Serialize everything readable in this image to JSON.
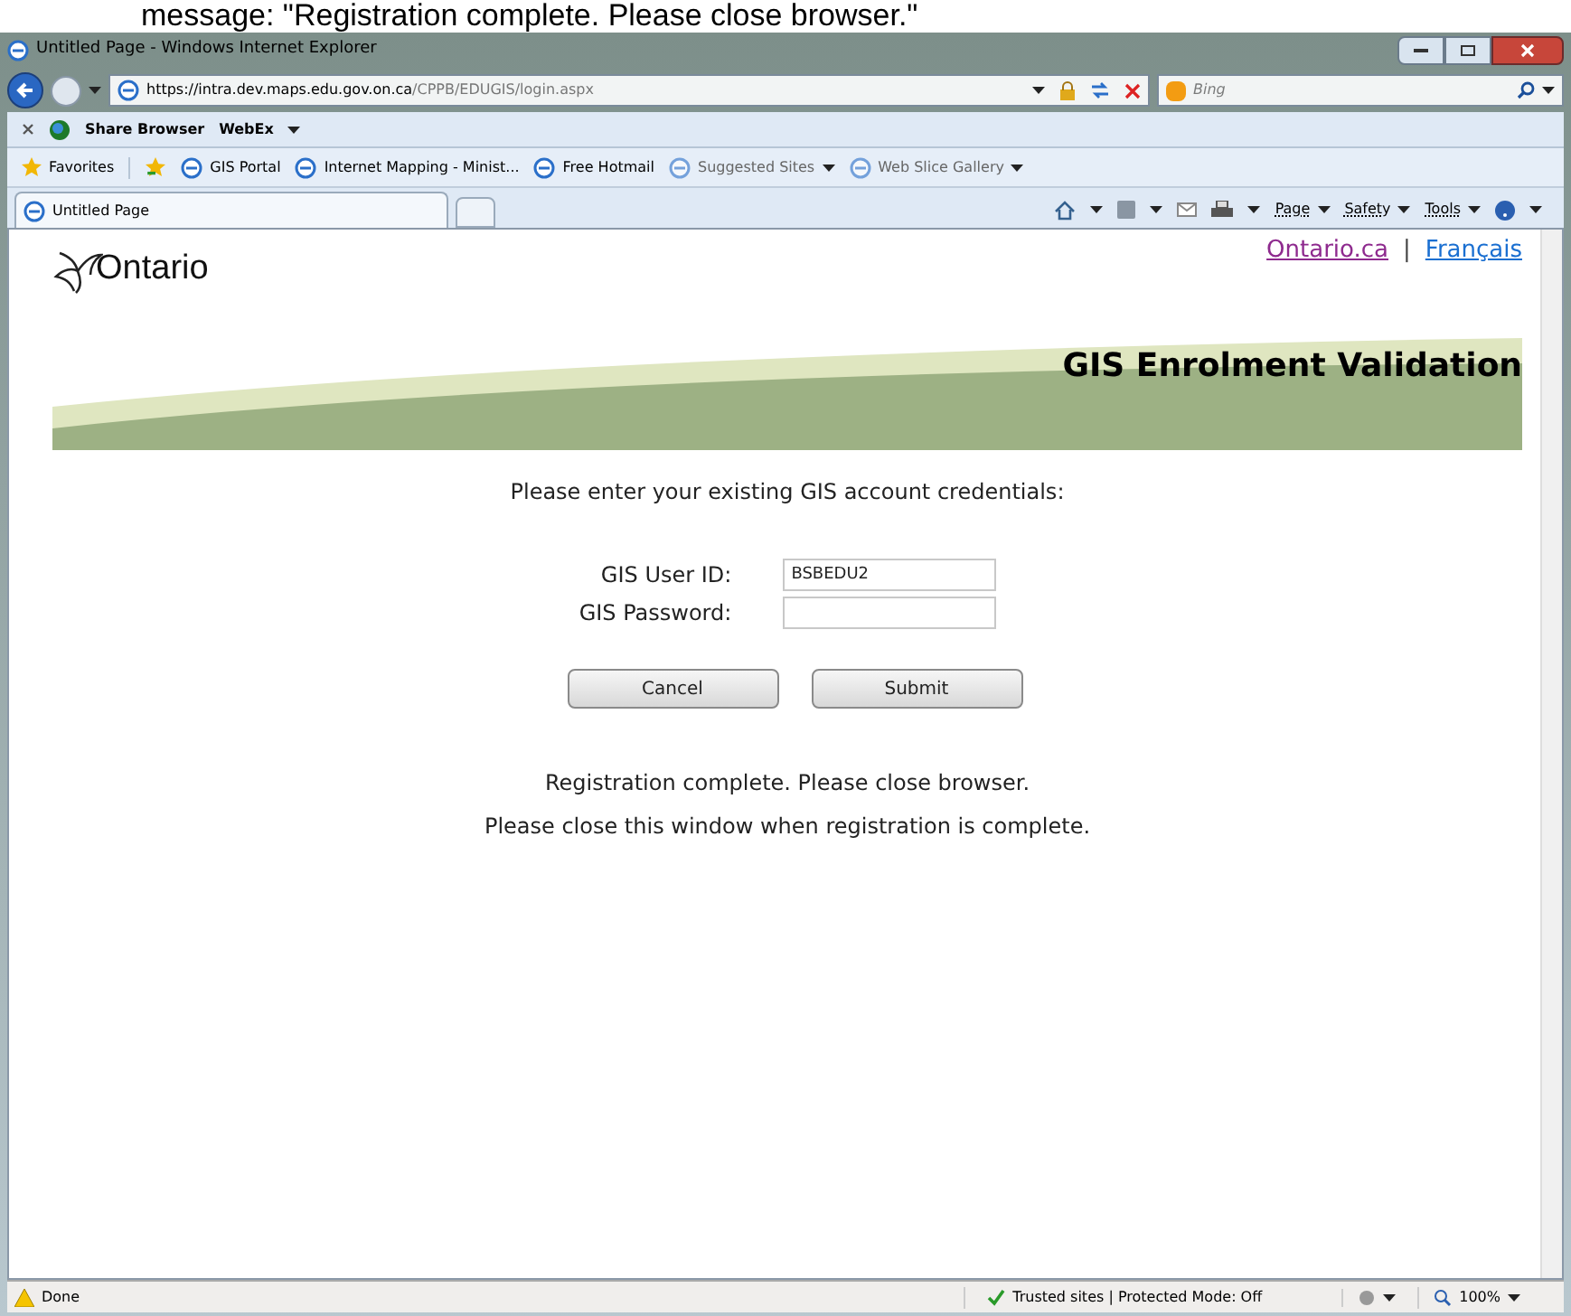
{
  "caption": "message: \"Registration complete. Please close browser.\"",
  "window": {
    "title": "Untitled Page - Windows Internet Explorer"
  },
  "address_bar": {
    "url_host": "https://intra.dev.maps.edu.gov.on.ca",
    "url_path": "/CPPB/EDUGIS/login.aspx",
    "search_placeholder": "Bing"
  },
  "toolbar": {
    "items": [
      "Share Browser",
      "WebEx"
    ]
  },
  "favorites_bar": {
    "favorites": "Favorites",
    "links": [
      {
        "label": "GIS Portal",
        "dropdown": false,
        "dim": false
      },
      {
        "label": "Internet Mapping - Minist...",
        "dropdown": false,
        "dim": false
      },
      {
        "label": "Free Hotmail",
        "dropdown": false,
        "dim": false
      },
      {
        "label": "Suggested Sites",
        "dropdown": true,
        "dim": true
      },
      {
        "label": "Web Slice Gallery",
        "dropdown": true,
        "dim": true
      }
    ]
  },
  "tabs": [
    {
      "label": "Untitled Page",
      "selected": true
    }
  ],
  "command_bar": [
    "Page",
    "Safety",
    "Tools"
  ],
  "page": {
    "logo": "Ontario",
    "links": [
      {
        "label": "Ontario.ca",
        "visited": true
      },
      {
        "label": "Français",
        "visited": false
      }
    ],
    "separator": "|",
    "banner_title": "GIS Enrolment Validation",
    "intro": "Please enter your existing GIS account credentials:",
    "fields": [
      {
        "label": "GIS User ID:",
        "value": "BSBEDU2"
      },
      {
        "label": "GIS Password:"
      }
    ],
    "buttons": [
      "Cancel",
      "Submit"
    ],
    "messages": [
      "Registration complete. Please close browser.",
      "Please close this window when registration is complete."
    ]
  },
  "status_bar": {
    "status": "Done",
    "zone": "Trusted sites | Protected Mode: Off",
    "zoom": "100%"
  }
}
